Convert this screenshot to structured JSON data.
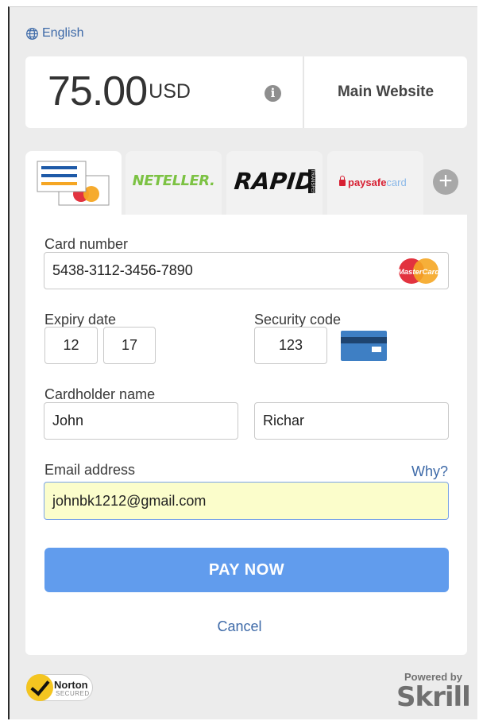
{
  "language": {
    "label": "English",
    "icon": "globe-icon"
  },
  "amount": {
    "value": "75.00",
    "currency": "USD"
  },
  "merchant": {
    "name": "Main Website"
  },
  "payment_tabs": [
    {
      "id": "card",
      "label": "",
      "icon": "credit-card-icon",
      "active": true
    },
    {
      "id": "neteller",
      "label": "NETELLER."
    },
    {
      "id": "rapid",
      "label": "RAPID",
      "sub": "TRANSFER"
    },
    {
      "id": "paysafecard",
      "label": "paysafe",
      "label2": "card"
    }
  ],
  "form": {
    "card_number_label": "Card number",
    "card_number_value": "5438-3112-3456-7890",
    "card_brand": "MasterCard",
    "expiry_label": "Expiry date",
    "expiry_month": "12",
    "expiry_year": "17",
    "security_label": "Security code",
    "security_value": "123",
    "cardholder_label": "Cardholder name",
    "first_name": "John",
    "last_name": "Richar",
    "email_label": "Email address",
    "email_value": "johnbk1212@gmail.com",
    "why_link": "Why?"
  },
  "actions": {
    "pay_label": "PAY NOW",
    "cancel_label": "Cancel"
  },
  "footer": {
    "norton_title": "Norton",
    "norton_sub": "SECURED",
    "powered_by": "Powered by",
    "skrill": "Skrill"
  },
  "colors": {
    "accent": "#619ced",
    "link": "#3e6aa8",
    "email_highlight": "#fbfdcb"
  }
}
